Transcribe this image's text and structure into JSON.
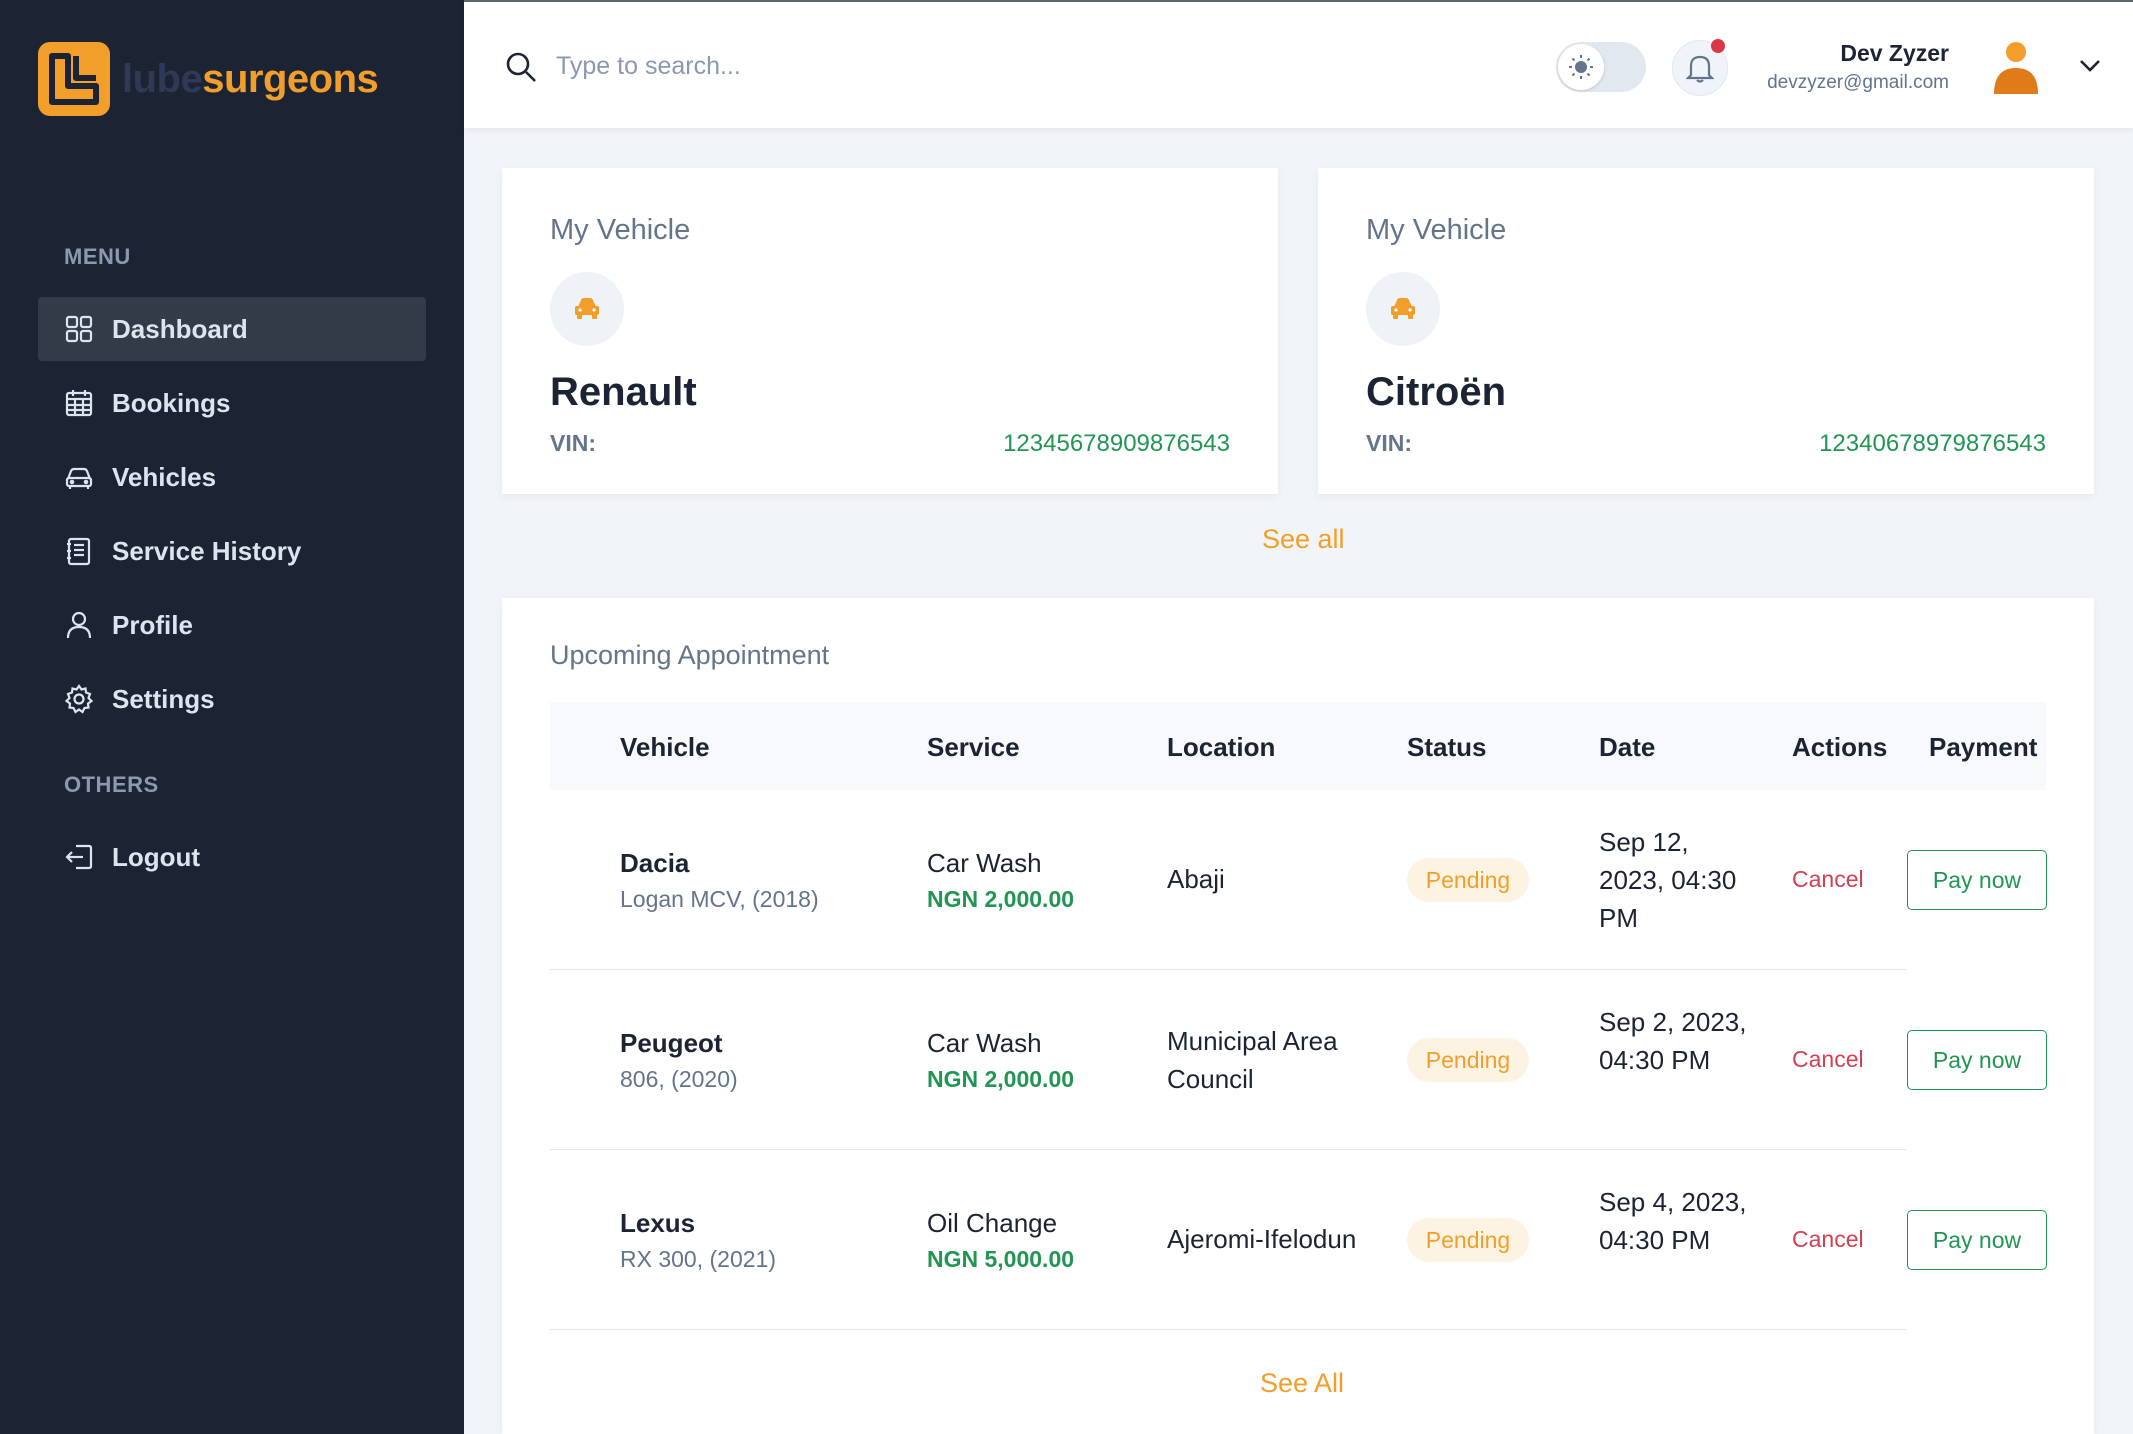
{
  "brand": {
    "part1": "lube",
    "part2": "surgeons"
  },
  "sidebar": {
    "menu_heading": "MENU",
    "others_heading": "OTHERS",
    "items": [
      {
        "label": "Dashboard",
        "icon": "dashboard-grid-icon",
        "active": true
      },
      {
        "label": "Bookings",
        "icon": "calendar-icon"
      },
      {
        "label": "Vehicles",
        "icon": "car-icon"
      },
      {
        "label": "Service History",
        "icon": "document-list-icon"
      },
      {
        "label": "Profile",
        "icon": "user-icon"
      },
      {
        "label": "Settings",
        "icon": "gear-icon"
      }
    ],
    "others": [
      {
        "label": "Logout",
        "icon": "logout-icon"
      }
    ]
  },
  "header": {
    "search_placeholder": "Type to search...",
    "user_name": "Dev Zyzer",
    "user_email": "devzyzer@gmail.com",
    "has_notification": true
  },
  "vehicles": [
    {
      "label": "My Vehicle",
      "name": "Renault",
      "vin_label": "VIN:",
      "vin": "12345678909876543"
    },
    {
      "label": "My Vehicle",
      "name": "Citroën",
      "vin_label": "VIN:",
      "vin": "12340678979876543"
    }
  ],
  "vehicles_see_all": "See all",
  "appointments": {
    "title": "Upcoming Appointment",
    "columns": [
      "Vehicle",
      "Service",
      "Location",
      "Status",
      "Date",
      "Actions",
      "Payment"
    ],
    "rows": [
      {
        "vehicle": "Dacia",
        "model": "Logan MCV, (2018)",
        "service": "Car Wash",
        "price": "NGN 2,000.00",
        "location": "Abaji",
        "status": "Pending",
        "date": "Sep 12, 2023, 04:30 PM",
        "action": "Cancel",
        "payment": "Pay now"
      },
      {
        "vehicle": "Peugeot",
        "model": "806, (2020)",
        "service": "Car Wash",
        "price": "NGN 2,000.00",
        "location": "Municipal Area Council",
        "status": "Pending",
        "date": "Sep 2, 2023, 04:30 PM",
        "action": "Cancel",
        "payment": "Pay now"
      },
      {
        "vehicle": "Lexus",
        "model": "RX 300, (2021)",
        "service": "Oil Change",
        "price": "NGN 5,000.00",
        "location": "Ajeromi-Ifelodun",
        "status": "Pending",
        "date": "Sep 4, 2023, 04:30 PM",
        "action": "Cancel",
        "payment": "Pay now"
      }
    ],
    "see_all": "See All"
  },
  "colors": {
    "sidebar_bg": "#1c2434",
    "accent": "#f19f2a",
    "success": "#219653",
    "danger": "#d34053"
  }
}
